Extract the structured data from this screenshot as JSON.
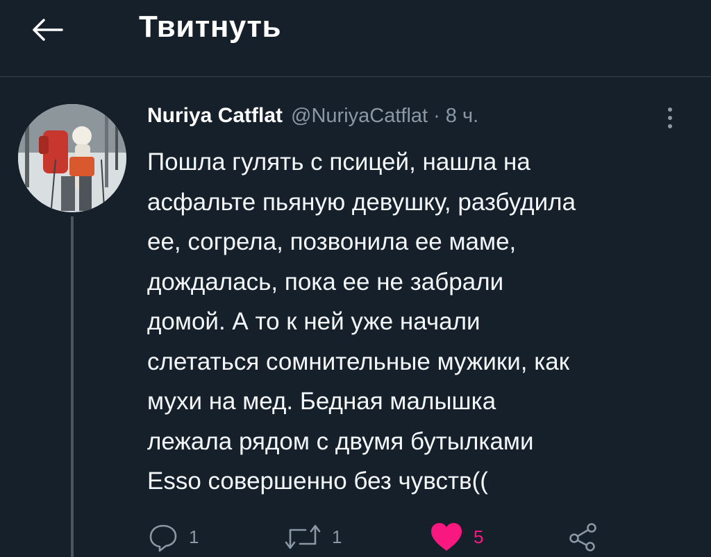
{
  "header": {
    "title": "Твитнуть",
    "back_icon": "arrow-left-icon"
  },
  "tweet": {
    "author_name": "Nuriya Catflat",
    "handle": "@NuriyaCatflat",
    "separator": "·",
    "time": "8 ч.",
    "text_lines": [
      "Пошла гулять с псицей, нашла на",
      "асфальте пьяную девушку, разбудила",
      "ее, согрела, позвонила ее маме,",
      "дождалась, пока ее не забрали",
      "домой. А то к ней уже начали",
      "слетаться сомнительные мужики, как",
      "мухи на мед. Бедная малышка",
      "лежала рядом с двумя бутылками",
      "Esso совершенно без чувств(("
    ]
  },
  "actions": {
    "reply_count": "1",
    "retweet_count": "1",
    "like_count": "5",
    "icons": [
      "reply-icon",
      "retweet-icon",
      "heart-icon",
      "share-icon"
    ]
  },
  "colors": {
    "background": "#15202b",
    "text": "#ffffff",
    "muted": "#8b98a5",
    "like": "#f91880",
    "divider": "#38444d"
  }
}
